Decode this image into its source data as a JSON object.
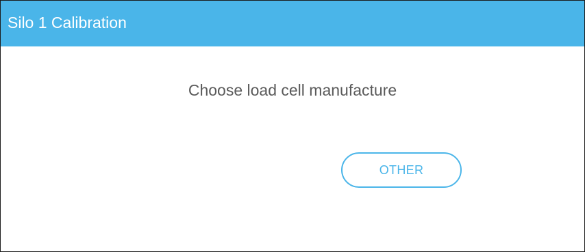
{
  "dialog": {
    "title": "Silo 1 Calibration",
    "prompt": "Choose load cell manufacture",
    "buttons": {
      "other_label": "OTHER"
    }
  },
  "colors": {
    "header_background": "#4ab5e9",
    "header_text": "#ffffff",
    "prompt_text": "#5a5a5a",
    "button_accent": "#4ab5e9"
  }
}
